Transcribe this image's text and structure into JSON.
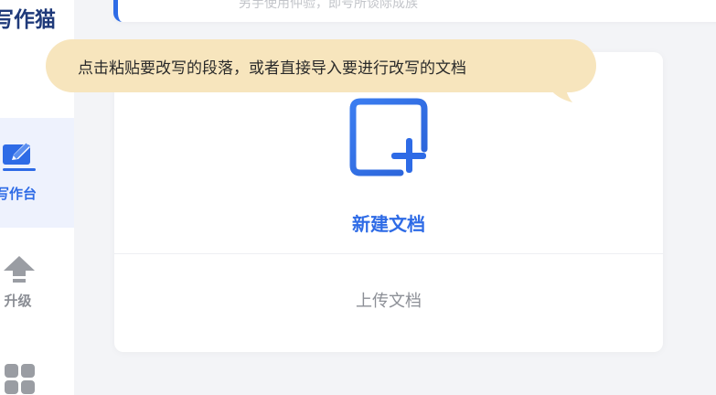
{
  "sidebar": {
    "brand": "写作猫",
    "items": [
      {
        "label": "写作台",
        "icon": "edit-icon",
        "active": true
      },
      {
        "label": "升级",
        "icon": "upgrade-arrow-icon",
        "active": false
      },
      {
        "label": "",
        "icon": "apps-grid-icon",
        "active": false
      }
    ]
  },
  "top_card": {
    "text": "另手使用仲验，即号所谈际成族"
  },
  "main": {
    "new_doc_label": "新建文档",
    "new_doc_icon": "new-document-icon",
    "upload_label": "上传文档"
  },
  "tooltip": {
    "text": "点击粘贴要改写的段落，或者直接导入要进行改写的文档"
  },
  "colors": {
    "accent": "#2e6be6",
    "active_bg": "#eef2fd",
    "tooltip_bg": "#f7e5bd",
    "page_bg": "#f3f4f7",
    "brand": "#1f3a7a"
  }
}
